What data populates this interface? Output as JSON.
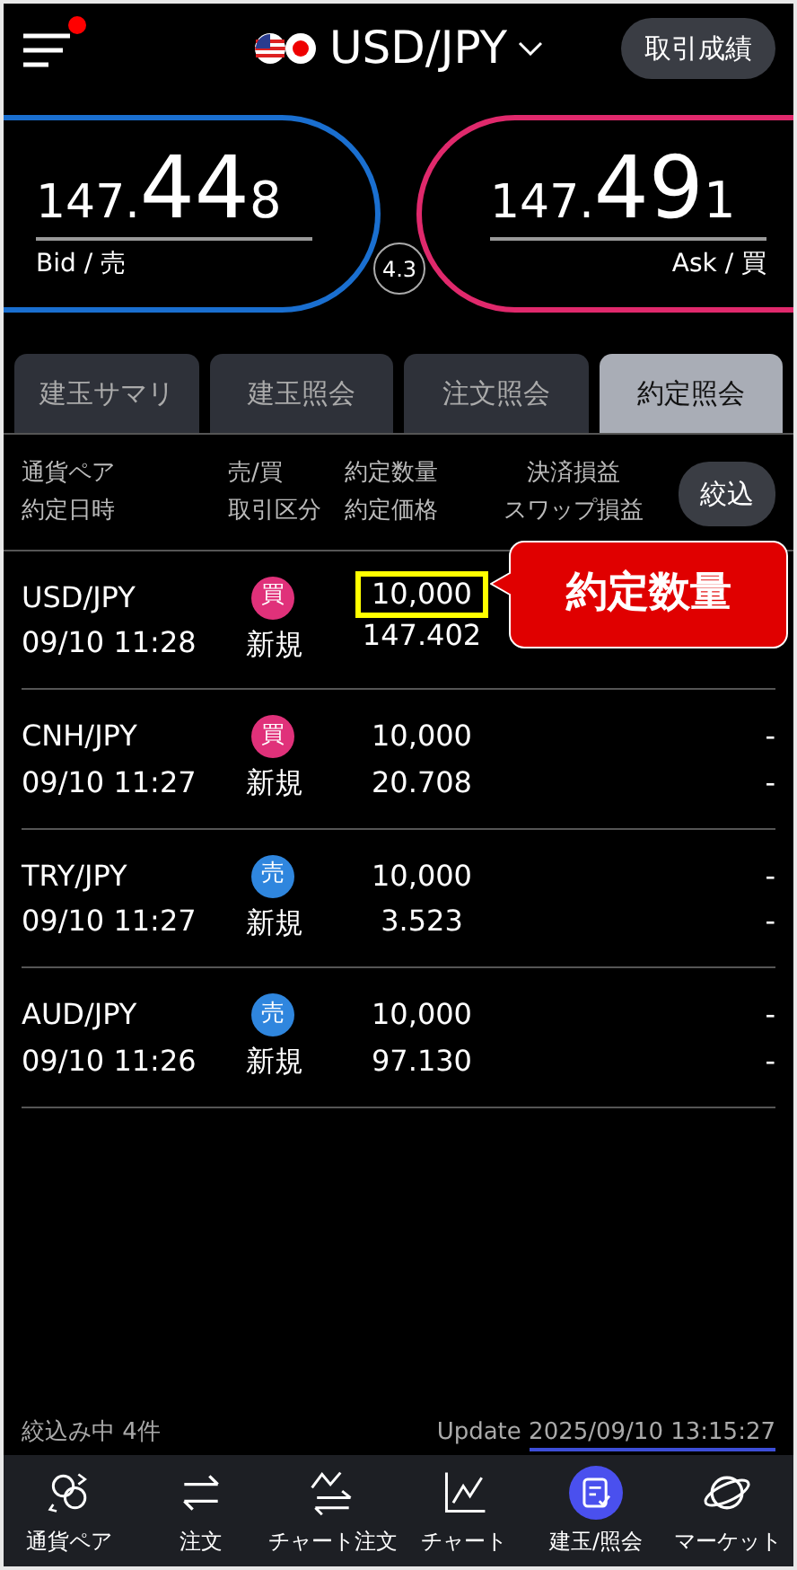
{
  "header": {
    "menu_badge": true,
    "pair": "USD/JPY",
    "history_button": "取引成績"
  },
  "bid": {
    "prefix": "147.",
    "big": "44",
    "suffix": "8",
    "label": "Bid / 売"
  },
  "spread": "4.3",
  "ask": {
    "prefix": "147.",
    "big": "49",
    "suffix": "1",
    "label": "Ask / 買"
  },
  "tabs": [
    {
      "label": "建玉サマリ",
      "selected": false
    },
    {
      "label": "建玉照会",
      "selected": false
    },
    {
      "label": "注文照会",
      "selected": false
    },
    {
      "label": "約定照会",
      "selected": true
    }
  ],
  "columns": [
    [
      "通貨ペア",
      "約定日時"
    ],
    [
      "売/買",
      "取引区分"
    ],
    [
      "約定数量",
      "約定価格"
    ],
    [
      "決済損益",
      "スワップ損益"
    ]
  ],
  "filter_button": "絞込",
  "rows": [
    {
      "pair": "USD/JPY",
      "datetime": "09/10 11:28",
      "side": "買",
      "color": "#e0317a",
      "category": "新規",
      "quantity": "10,000",
      "price": "147.402",
      "highlighted": true,
      "callout": "約定数量"
    },
    {
      "pair": "CNH/JPY",
      "datetime": "09/10 11:27",
      "side": "買",
      "color": "#e0317a",
      "category": "新規",
      "quantity": "10,000",
      "price": "20.708",
      "highlighted": false,
      "pl": "-",
      "swap": "-"
    },
    {
      "pair": "TRY/JPY",
      "datetime": "09/10 11:27",
      "side": "売",
      "color": "#2f86de",
      "category": "新規",
      "quantity": "10,000",
      "price": "3.523",
      "highlighted": false,
      "pl": "-",
      "swap": "-"
    },
    {
      "pair": "AUD/JPY",
      "datetime": "09/10 11:26",
      "side": "売",
      "color": "#2f86de",
      "category": "新規",
      "quantity": "10,000",
      "price": "97.130",
      "highlighted": false,
      "pl": "-",
      "swap": "-"
    }
  ],
  "status": {
    "filter": "絞込み中 4件",
    "update_label": "Update",
    "update_time": "2025/09/10 13:15:27"
  },
  "nav": [
    {
      "label": "通貨ペア",
      "kind": "pair",
      "selected": false
    },
    {
      "label": "注文",
      "kind": "order",
      "selected": false
    },
    {
      "label": "チャート注文",
      "kind": "chartorder",
      "selected": false
    },
    {
      "label": "チャート",
      "kind": "chart",
      "selected": false
    },
    {
      "label": "建玉/照会",
      "kind": "position",
      "selected": true
    },
    {
      "label": "マーケット",
      "kind": "market",
      "selected": false
    }
  ]
}
